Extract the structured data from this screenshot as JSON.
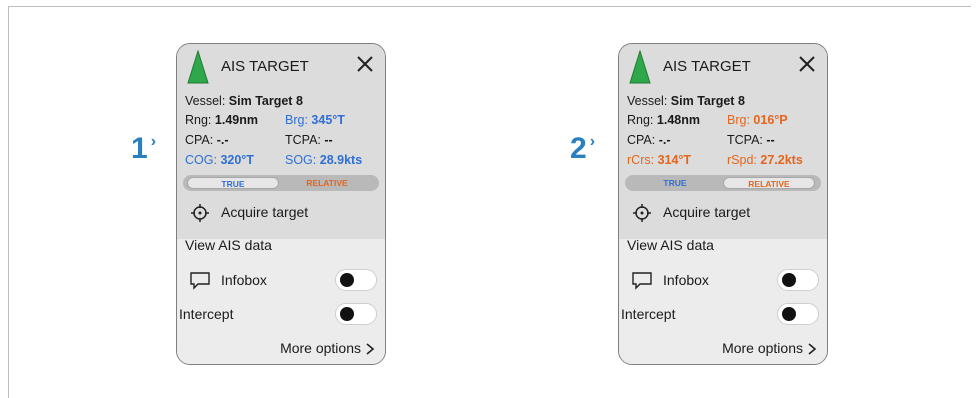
{
  "labels": [
    {
      "number": "1",
      "chevron": "›"
    },
    {
      "number": "2",
      "chevron": "›"
    }
  ],
  "panels": [
    {
      "title": "AIS TARGET",
      "vessel_label": "Vessel:",
      "vessel_name": "Sim Target 8",
      "rng_label": "Rng:",
      "rng_value": "1.49nm",
      "brg_label": "Brg:",
      "brg_value": "345°T",
      "cpa_label": "CPA:",
      "cpa_value": "-.-",
      "tcpa_label": "TCPA:",
      "tcpa_value": "--",
      "cog_label": "COG:",
      "cog_value": "320°T",
      "sog_label": "SOG:",
      "sog_value": "28.9kts",
      "toggle_true": "TRUE",
      "toggle_relative": "RELATIVE",
      "active_mode": "TRUE",
      "acquire_label": "Acquire target",
      "view_ais_label": "View AIS data",
      "infobox_label": "Infobox",
      "intercept_label": "Intercept",
      "more_label": "More options",
      "colors": {
        "bearing": "#2f6fd6",
        "course": "#2f6fd6",
        "speed": "#2f6fd6"
      }
    },
    {
      "title": "AIS TARGET",
      "vessel_label": "Vessel:",
      "vessel_name": "Sim Target 8",
      "rng_label": "Rng:",
      "rng_value": "1.48nm",
      "brg_label": "Brg:",
      "brg_value": "016°P",
      "cpa_label": "CPA:",
      "cpa_value": "-.-",
      "tcpa_label": "TCPA:",
      "tcpa_value": "--",
      "cog_label": "rCrs:",
      "cog_value": "314°T",
      "sog_label": "rSpd:",
      "sog_value": "27.2kts",
      "toggle_true": "TRUE",
      "toggle_relative": "RELATIVE",
      "active_mode": "RELATIVE",
      "acquire_label": "Acquire target",
      "view_ais_label": "View AIS data",
      "infobox_label": "Infobox",
      "intercept_label": "Intercept",
      "more_label": "More options",
      "colors": {
        "bearing": "#e4661e",
        "course": "#e4661e",
        "speed": "#e4661e"
      }
    }
  ],
  "icons": {
    "target": "green-triangle-icon",
    "close": "close-icon",
    "acquire": "crosshair-icon",
    "infobox": "speech-bubble-icon",
    "more": "chevron-right-icon"
  }
}
